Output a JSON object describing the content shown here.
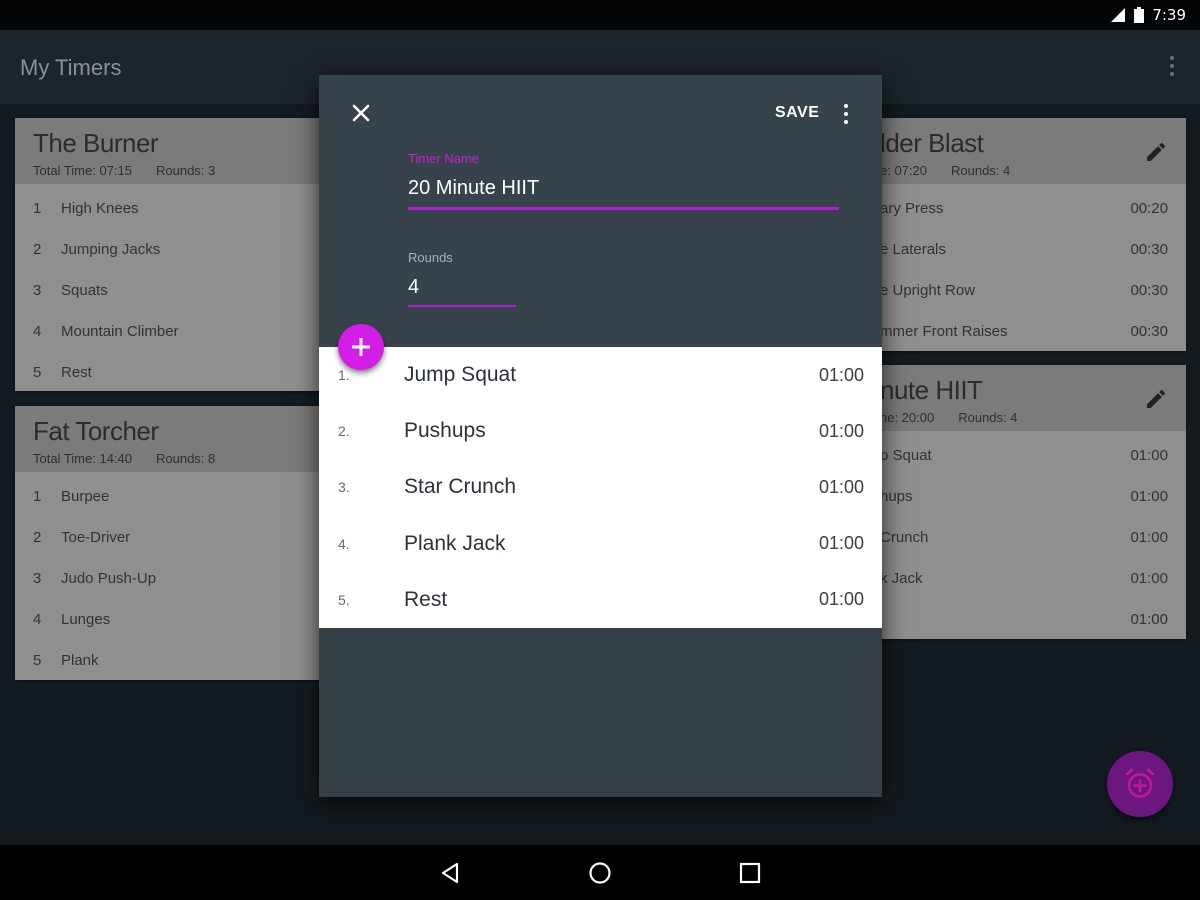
{
  "status_bar": {
    "time": "7:39"
  },
  "app_bar": {
    "title": "My Timers"
  },
  "cards": [
    {
      "title": "The Burner",
      "total_time": "Total Time: 07:15",
      "rounds": "Rounds: 3",
      "rows": [
        {
          "idx": "1",
          "name": "High Knees",
          "dur": ""
        },
        {
          "idx": "2",
          "name": "Jumping Jacks",
          "dur": ""
        },
        {
          "idx": "3",
          "name": "Squats",
          "dur": ""
        },
        {
          "idx": "4",
          "name": "Mountain Climber",
          "dur": ""
        },
        {
          "idx": "5",
          "name": "Rest",
          "dur": ""
        }
      ]
    },
    {
      "title": "Fat Torcher",
      "total_time": "Total Time: 14:40",
      "rounds": "Rounds: 8",
      "rows": [
        {
          "idx": "1",
          "name": "Burpee",
          "dur": ""
        },
        {
          "idx": "2",
          "name": "Toe-Driver",
          "dur": ""
        },
        {
          "idx": "3",
          "name": "Judo Push-Up",
          "dur": ""
        },
        {
          "idx": "4",
          "name": "Lunges",
          "dur": ""
        },
        {
          "idx": "5",
          "name": "Plank",
          "dur": ""
        }
      ]
    },
    {
      "title": "lder Blast",
      "total_time": "e: 07:20",
      "rounds": "Rounds: 4",
      "rows": [
        {
          "idx": "",
          "name": "ary Press",
          "dur": "00:20"
        },
        {
          "idx": "",
          "name": "e Laterals",
          "dur": "00:30"
        },
        {
          "idx": "",
          "name": "e Upright Row",
          "dur": "00:30"
        },
        {
          "idx": "",
          "name": "mmer Front Raises",
          "dur": "00:30"
        }
      ]
    },
    {
      "title": "nute HIIT",
      "total_time": "ne: 20:00",
      "rounds": "Rounds: 4",
      "rows": [
        {
          "idx": "",
          "name": "p Squat",
          "dur": "01:00"
        },
        {
          "idx": "",
          "name": "hups",
          "dur": "01:00"
        },
        {
          "idx": "",
          "name": "Crunch",
          "dur": "01:00"
        },
        {
          "idx": "",
          "name": "k Jack",
          "dur": "01:00"
        },
        {
          "idx": "",
          "name": "",
          "dur": "01:00"
        }
      ]
    }
  ],
  "dialog": {
    "save_label": "SAVE",
    "timer_name_label": "Timer Name",
    "timer_name_value": "20 Minute HIIT",
    "rounds_label": "Rounds",
    "rounds_value": "4",
    "exercises": [
      {
        "idx": "1.",
        "name": "Jump Squat",
        "dur": "01:00"
      },
      {
        "idx": "2.",
        "name": "Pushups",
        "dur": "01:00"
      },
      {
        "idx": "3.",
        "name": "Star Crunch",
        "dur": "01:00"
      },
      {
        "idx": "4.",
        "name": "Plank Jack",
        "dur": "01:00"
      },
      {
        "idx": "5.",
        "name": "Rest",
        "dur": "01:00"
      }
    ]
  },
  "colors": {
    "accent": "#c622d4",
    "fab": "#d21ee6",
    "dialog_bg": "#36434b"
  }
}
